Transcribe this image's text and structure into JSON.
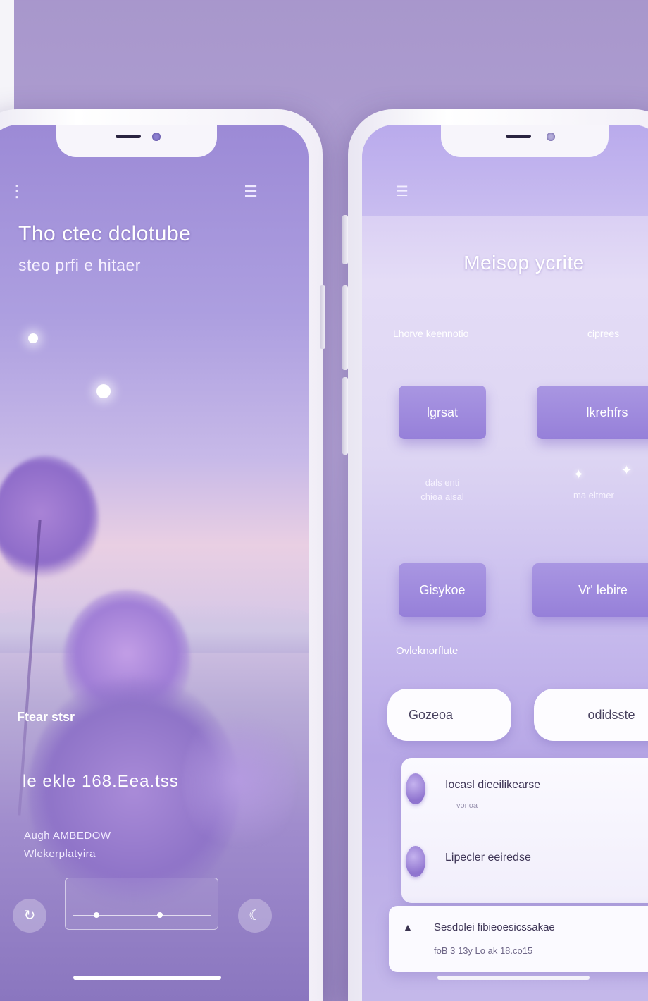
{
  "colors": {
    "background": "#b7a7d8",
    "accent_purple": "#9680d9",
    "card_white": "#fbfaff",
    "text_dark": "#3e3556"
  },
  "left_phone": {
    "menu_icon": "menu-icon",
    "profile_icon": "profile-icon",
    "title": "Tho ctec dclotube",
    "subtitle": "steo prfi e hitaer",
    "label_1": "Ftear stsr",
    "label_2": "le ekle 168.Eea.tss",
    "label_3": "Augh AMBEDOW",
    "label_4": "Wlekerplatyira",
    "left_control_icon": "replay-icon",
    "right_control_icon": "moon-icon"
  },
  "right_phone": {
    "menu_icon": "menu-icon",
    "title": "Meisop ycrite",
    "row_left": "Lhorve keennotio",
    "row_right": "ciprees",
    "buttons": [
      {
        "label": "lgrsat"
      },
      {
        "label": "lkrehfrs"
      },
      {
        "label": "Gisykoe"
      },
      {
        "label": "Vr' lebire"
      }
    ],
    "caption_1_line_1": "dals enti",
    "caption_1_line_2": "chiea aisal",
    "caption_2": "ma eltmer",
    "section_label": "Ovleknorflute",
    "pills": [
      {
        "label": "Gozeoa"
      },
      {
        "label": "odidsste"
      }
    ],
    "list_items": [
      {
        "title": "Iocasl dieeilikearse",
        "sub": "vonoa",
        "icon": "orb-icon"
      },
      {
        "title": "Lipecler eeiredse",
        "sub": "",
        "icon": "orb-icon"
      }
    ],
    "bottom_card": {
      "icon": "chevron-up-icon",
      "title": "Sesdolei fibieoesicssakae",
      "sub": "foB 3 13y Lo ak  18.co15"
    }
  }
}
